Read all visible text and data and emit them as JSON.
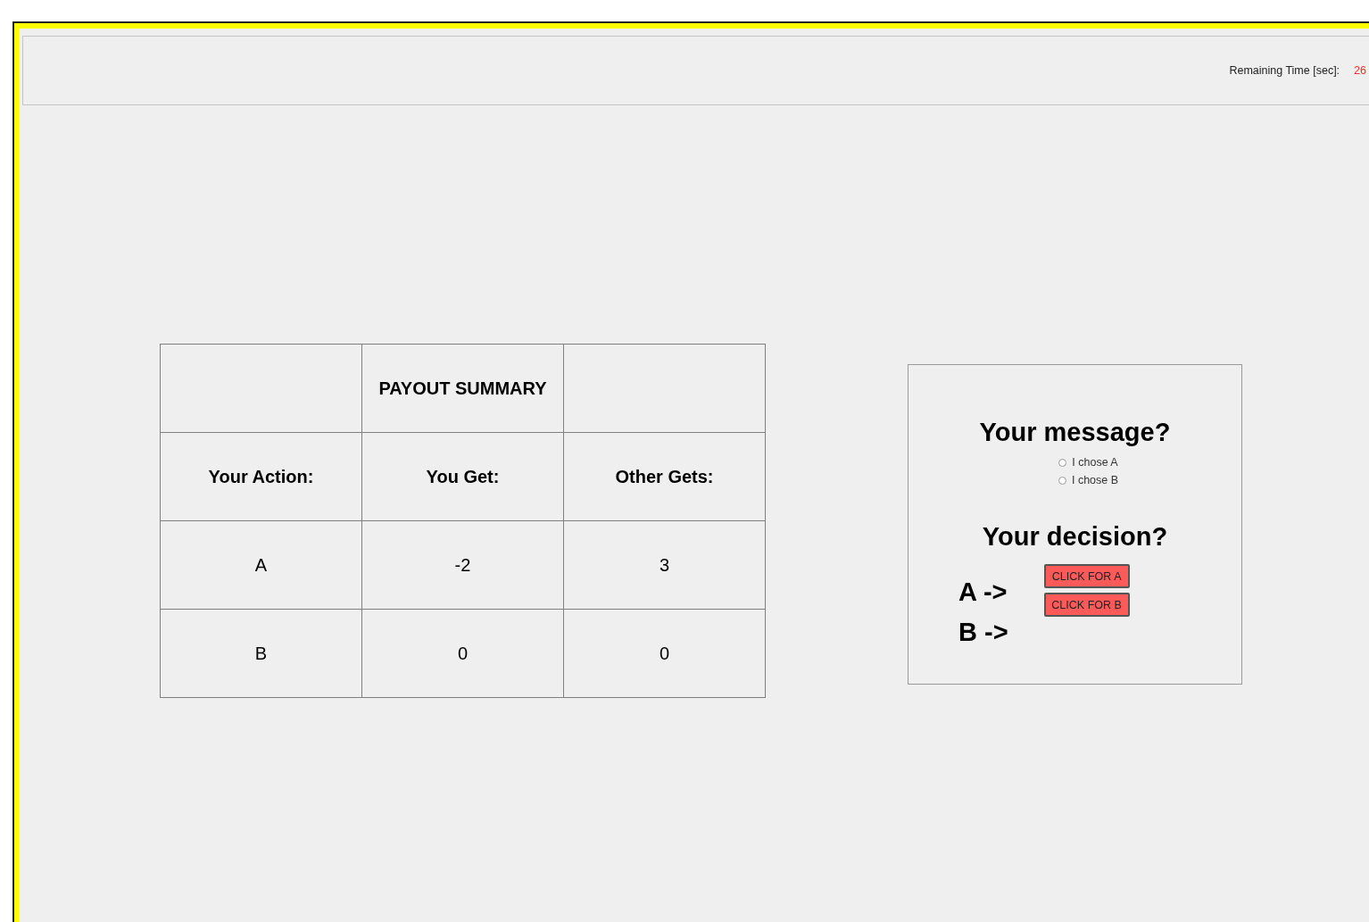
{
  "timer": {
    "label": "Remaining Time [sec]:",
    "value": "26"
  },
  "payout_table": {
    "title": "PAYOUT SUMMARY",
    "columns": [
      "Your Action:",
      "You Get:",
      "Other Gets:"
    ],
    "rows": [
      [
        "A",
        "-2",
        "3"
      ],
      [
        "B",
        "0",
        "0"
      ]
    ]
  },
  "decision_panel": {
    "message_heading": "Your message?",
    "message_options": [
      {
        "label": "I chose A",
        "selected": false
      },
      {
        "label": "I chose B",
        "selected": false
      }
    ],
    "decision_heading": "Your decision?",
    "choice_labels": [
      "A ->",
      "B ->"
    ],
    "buttons": [
      "CLICK FOR A",
      "CLICK FOR B"
    ]
  }
}
